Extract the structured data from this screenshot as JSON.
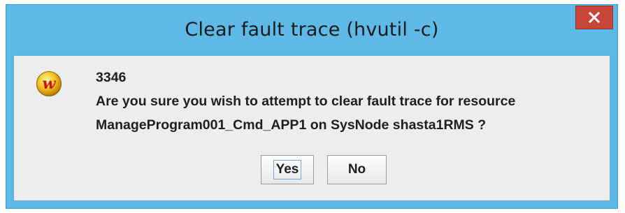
{
  "window": {
    "title": "Clear fault trace (hvutil -c)",
    "close_symbol": "x"
  },
  "dialog": {
    "icon": "w-logo-icon",
    "code": "3346",
    "message_line1": "Are you sure you wish to attempt to clear fault trace for resource",
    "message_line2": "ManageProgram001_Cmd_APP1 on SysNode shasta1RMS ?"
  },
  "buttons": {
    "yes_label": "Yes",
    "no_label": "No"
  },
  "colors": {
    "frame": "#5fb9e6",
    "close": "#c7453a",
    "content_bg": "#ededed"
  }
}
